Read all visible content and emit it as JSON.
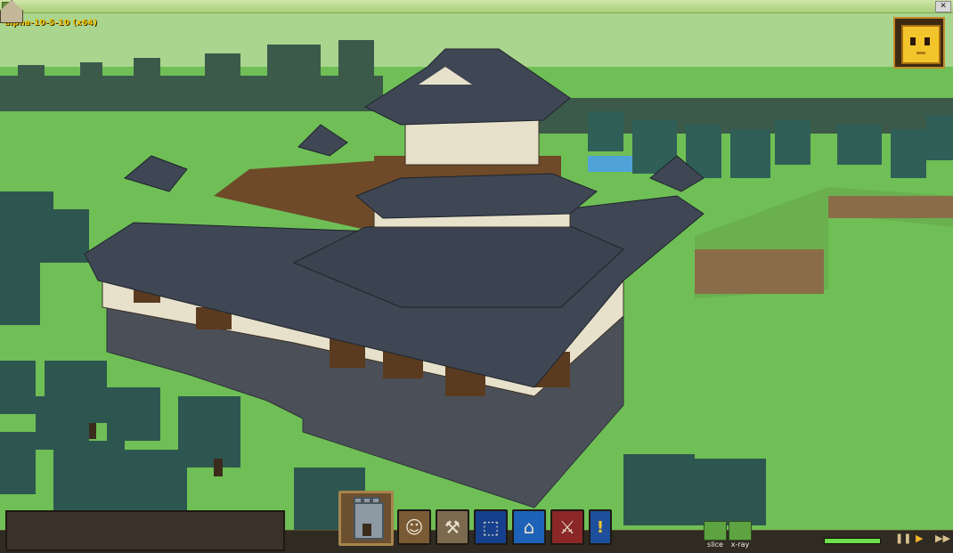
{
  "window": {
    "close_glyph": "✕"
  },
  "hud": {
    "version": "alpha-10-5-10 (x64)"
  },
  "toolbar": {
    "castle_icon": "castle-icon",
    "tools": [
      {
        "name": "worker",
        "icon": "worker-icon"
      },
      {
        "name": "build",
        "icon": "tools-icon"
      },
      {
        "name": "zone",
        "icon": "zone-icon"
      },
      {
        "name": "house",
        "icon": "house-icon"
      },
      {
        "name": "attack",
        "icon": "sword-icon"
      },
      {
        "name": "alert",
        "icon": "exclamation-icon",
        "glyph": "!"
      }
    ]
  },
  "view_controls": {
    "slice_label": "slice",
    "xray_label": "x-ray"
  },
  "time_controls": {
    "pause_glyph": "❚❚",
    "play_glyph": "▶",
    "fast_forward_glyph": "▶▶",
    "progress": 1.0
  },
  "colors": {
    "grass": "#6fbf56",
    "roof": "#3f4654",
    "wall": "#e7e1cc",
    "stone": "#4b5058",
    "wood": "#5a3b1f",
    "accent": "#f5c400"
  }
}
